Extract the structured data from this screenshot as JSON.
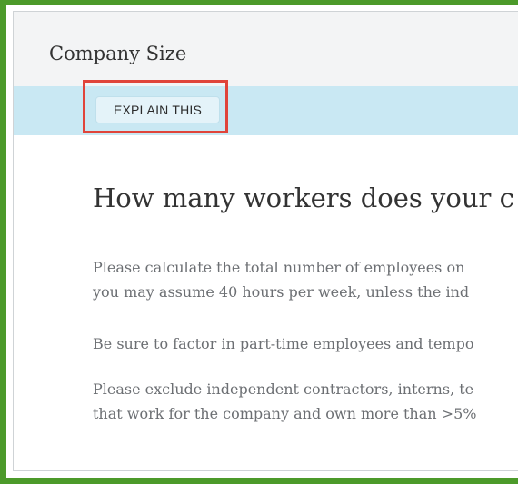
{
  "section": {
    "title": "Company Size"
  },
  "explain_button": {
    "label": "EXPLAIN THIS"
  },
  "question": {
    "heading": "How many workers does your c"
  },
  "paragraphs": [
    {
      "lines": [
        "Please calculate the total number of employees on",
        "you may assume 40 hours per week, unless the ind"
      ]
    },
    {
      "lines": [
        "Be sure to factor in part-time employees and tempo"
      ]
    },
    {
      "lines": [
        "Please exclude independent contractors, interns, te",
        "that work for the company and own more than >5%"
      ]
    }
  ],
  "colors": {
    "frame_border": "#4c9a2a",
    "highlight_border": "#e0443a",
    "band": "#c9e8f3",
    "header_bg": "#f3f4f5"
  }
}
